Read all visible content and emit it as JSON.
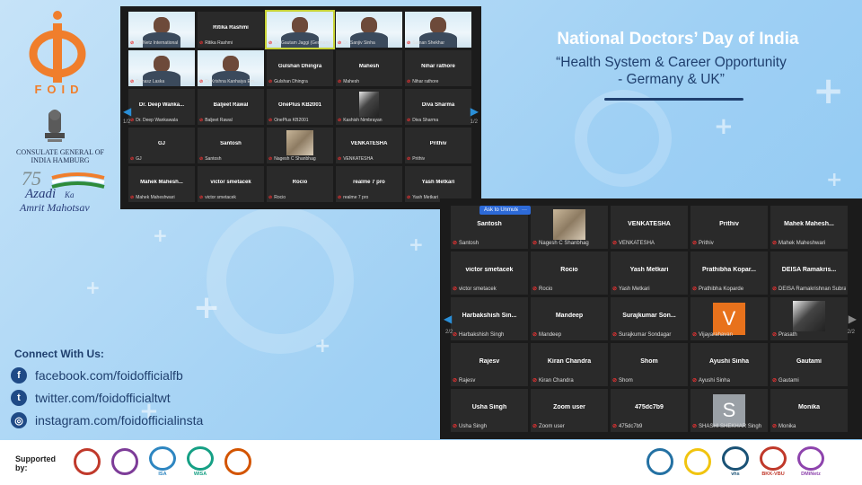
{
  "branding": {
    "foid_text": "FOID",
    "consulate": "CONSULATE GENERAL OF INDIA HAMBURG",
    "azadi_line1": "Azadi",
    "azadi_ka": "Ka",
    "azadi_line2": "Amrit Mahotsav",
    "azadi_number": "75",
    "colors": {
      "orange": "#f07e2c",
      "navy": "#1f3f6e"
    }
  },
  "headline": {
    "title": "National Doctors’ Day of India",
    "subtitle_line1": "“Health System & Career Opportunity",
    "subtitle_line2": "- Germany & UK”"
  },
  "zoom_top": {
    "page_left": "1/2",
    "page_right": "1/2",
    "tiles": [
      {
        "name": "",
        "foot": "DMNetz International",
        "kind": "video"
      },
      {
        "name": "Ritika Rashmi",
        "foot": "Ritika Rashmi",
        "kind": "name"
      },
      {
        "name": "",
        "foot": "Dr. Gautam Jaggi (Germany)",
        "kind": "video",
        "talk": true
      },
      {
        "name": "",
        "foot": "Dr. Sanjiv Sinha",
        "kind": "video"
      },
      {
        "name": "",
        "foot": "Suman Shekhar",
        "kind": "video"
      },
      {
        "name": "",
        "foot": "Tomasz Laska",
        "kind": "video"
      },
      {
        "name": "",
        "foot": "Dr Krishna Kanhaiya Em...",
        "kind": "video"
      },
      {
        "name": "Gulshan Dhingra",
        "foot": "Gulshan Dhingra",
        "kind": "name"
      },
      {
        "name": "Mahesh",
        "foot": "Mahesh",
        "kind": "name"
      },
      {
        "name": "Nihar rathore",
        "foot": "Nihar rathore",
        "kind": "name"
      },
      {
        "name": "Dr. Deep Wanka...",
        "foot": "Dr. Deep Wankawala",
        "kind": "name"
      },
      {
        "name": "Baljeet Rawal",
        "foot": "Baljeet Rawal",
        "kind": "name"
      },
      {
        "name": "OnePlus KB2001",
        "foot": "OnePlus KB2001",
        "kind": "name"
      },
      {
        "name": "",
        "foot": "Kashish Nimbrayan",
        "kind": "photo-dark"
      },
      {
        "name": "Diva Sharma",
        "foot": "Diva Sharma",
        "kind": "name"
      },
      {
        "name": "GJ",
        "foot": "GJ",
        "kind": "name"
      },
      {
        "name": "Santosh",
        "foot": "Santosh",
        "kind": "name"
      },
      {
        "name": "",
        "foot": "Nagesh C Shanbhag",
        "kind": "photo"
      },
      {
        "name": "VENKATESHA",
        "foot": "VENKATESHA",
        "kind": "name"
      },
      {
        "name": "Prithiv",
        "foot": "Prithiv",
        "kind": "name"
      },
      {
        "name": "Mahek Mahesh...",
        "foot": "Mahek Maheshwari",
        "kind": "name"
      },
      {
        "name": "victor smetacek",
        "foot": "victor smetacek",
        "kind": "name"
      },
      {
        "name": "Rocio",
        "foot": "Rocio",
        "kind": "name"
      },
      {
        "name": "realme 7 pro",
        "foot": "realme 7 pro",
        "kind": "name"
      },
      {
        "name": "Yash Metkari",
        "foot": "Yash Metkari",
        "kind": "name"
      }
    ]
  },
  "zoom_bottom": {
    "unmute_label": "Ask to Unmute",
    "more_label": "···",
    "page_left": "2/2",
    "page_right": "2/2",
    "tiles": [
      {
        "name": "Santosh",
        "foot": "Santosh",
        "kind": "name"
      },
      {
        "name": "",
        "foot": "Nagesh C Shanbhag",
        "kind": "photo"
      },
      {
        "name": "VENKATESHA",
        "foot": "VENKATESHA",
        "kind": "name"
      },
      {
        "name": "Prithiv",
        "foot": "Prithiv",
        "kind": "name"
      },
      {
        "name": "Mahek Mahesh...",
        "foot": "Mahek Maheshwari",
        "kind": "name"
      },
      {
        "name": "victor smetacek",
        "foot": "victor smetacek",
        "kind": "name"
      },
      {
        "name": "Rocio",
        "foot": "Rocio",
        "kind": "name"
      },
      {
        "name": "Yash Metkari",
        "foot": "Yash Metkari",
        "kind": "name"
      },
      {
        "name": "Prathibha Kopar...",
        "foot": "Prathibha Koparde",
        "kind": "name"
      },
      {
        "name": "DEISA Ramakris...",
        "foot": "DEISA Ramakrishnan Subra...",
        "kind": "name"
      },
      {
        "name": "Harbakshish Sin...",
        "foot": "Harbakshish Singh",
        "kind": "name"
      },
      {
        "name": "Mandeep",
        "foot": "Mandeep",
        "kind": "name"
      },
      {
        "name": "Surajkumar Son...",
        "foot": "Surajkumar Sondagar",
        "kind": "name"
      },
      {
        "name": "",
        "foot": "Vijayarahavan",
        "kind": "avatar",
        "letter": "V",
        "color": "#e8721c"
      },
      {
        "name": "",
        "foot": "Prasath",
        "kind": "photo-dark"
      },
      {
        "name": "Rajesv",
        "foot": "Rajesv",
        "kind": "name"
      },
      {
        "name": "Kiran Chandra",
        "foot": "Kiran Chandra",
        "kind": "name"
      },
      {
        "name": "Shom",
        "foot": "Shom",
        "kind": "name"
      },
      {
        "name": "Ayushi Sinha",
        "foot": "Ayushi Sinha",
        "kind": "name"
      },
      {
        "name": "Gautami",
        "foot": "Gautami",
        "kind": "name"
      },
      {
        "name": "Usha Singh",
        "foot": "Usha Singh",
        "kind": "name"
      },
      {
        "name": "Zoom user",
        "foot": "Zoom user",
        "kind": "name"
      },
      {
        "name": "475dc7b9",
        "foot": "475dc7b9",
        "kind": "name"
      },
      {
        "name": "",
        "foot": "SHASHI SHEKHAR Singh",
        "kind": "avatar",
        "letter": "S",
        "color": "#9aa0a6"
      },
      {
        "name": "Monika",
        "foot": "Monika",
        "kind": "name"
      }
    ]
  },
  "connect": {
    "heading": "Connect With Us:",
    "links": [
      {
        "icon": "facebook-icon",
        "glyph": "f",
        "text": "facebook.com/foidofficialfb"
      },
      {
        "icon": "twitter-icon",
        "glyph": "t",
        "text": "twitter.com/foidofficialtwt"
      },
      {
        "icon": "instagram-icon",
        "glyph": "◎",
        "text": "instagram.com/foidofficialinsta"
      }
    ]
  },
  "supported": {
    "label": "Supported by:",
    "logos_left": [
      {
        "name": "deutsch-indische-logo",
        "color": "#c0392b"
      },
      {
        "name": "purple-seal-logo",
        "color": "#7d3c98"
      },
      {
        "name": "isa-logo",
        "color": "#2e86c1",
        "text": "ISA"
      },
      {
        "name": "wisa-logo",
        "color": "#16a085",
        "text": "WISA"
      },
      {
        "name": "marathi-logo",
        "color": "#d35400"
      }
    ],
    "logos_right": [
      {
        "name": "wings-logo",
        "color": "#2471a3"
      },
      {
        "name": "yellow-seal-logo",
        "color": "#f1c40f"
      },
      {
        "name": "vhs-shaktya-logo",
        "color": "#1a5276",
        "text": "vhs"
      },
      {
        "name": "bkk-vbu-logo",
        "color": "#c0392b",
        "text": "BKK-VBU"
      },
      {
        "name": "dminetz-logo",
        "color": "#8e44ad",
        "text": "DMiNetz"
      }
    ]
  }
}
